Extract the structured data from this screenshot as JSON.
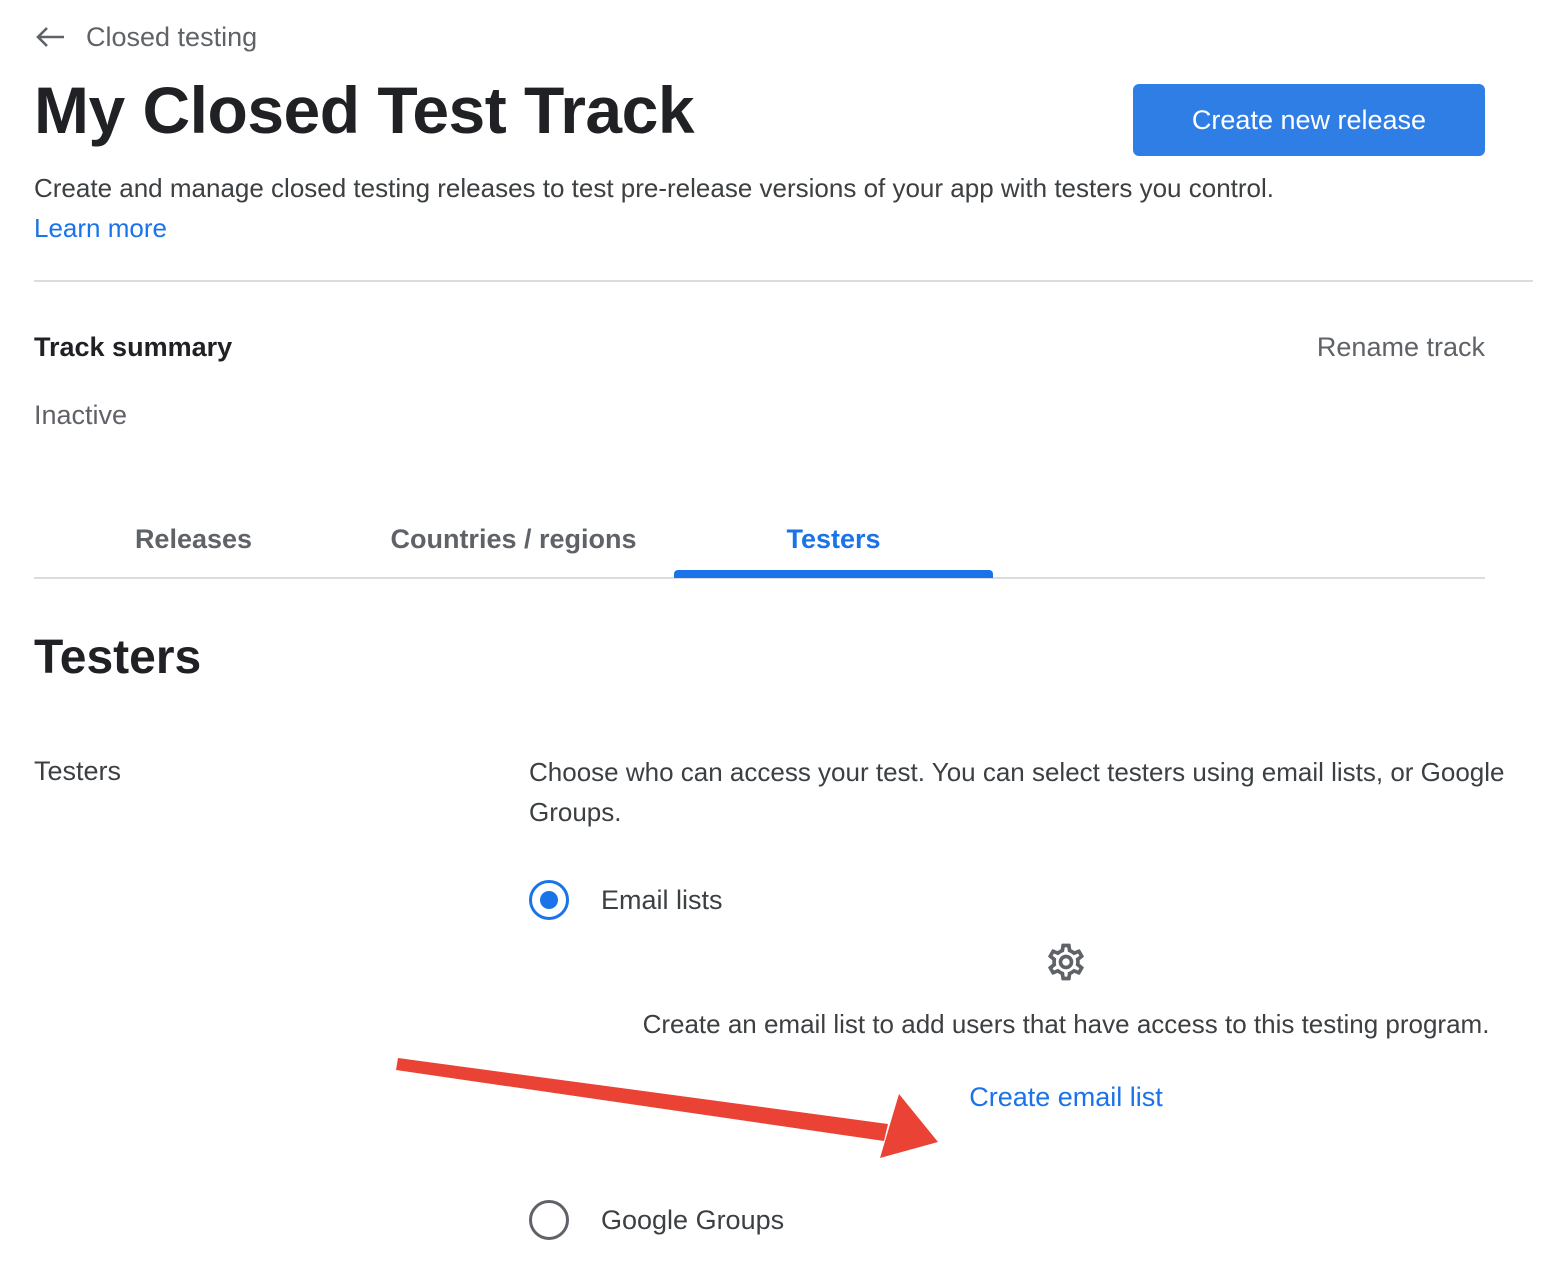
{
  "nav": {
    "back_label": "Closed testing",
    "back_icon": "arrow-left-icon"
  },
  "header": {
    "title": "My Closed Test Track",
    "primary_button": "Create new release",
    "description": "Create and manage closed testing releases to test pre-release versions of your app with testers you control.",
    "learn_more": "Learn more"
  },
  "summary": {
    "title": "Track summary",
    "rename": "Rename track",
    "status": "Inactive"
  },
  "tabs": [
    {
      "label": "Releases",
      "active": false
    },
    {
      "label": "Countries / regions",
      "active": false
    },
    {
      "label": "Testers",
      "active": true
    }
  ],
  "testers_section": {
    "heading": "Testers",
    "field_label": "Testers",
    "help_text": "Choose who can access your test. You can select testers using email lists, or Google Groups.",
    "options": [
      {
        "label": "Email lists",
        "selected": true
      },
      {
        "label": "Google Groups",
        "selected": false
      }
    ],
    "empty_state": {
      "icon": "gear-icon",
      "text": "Create an email list to add users that have access to this testing program.",
      "link": "Create email list"
    }
  },
  "colors": {
    "accent": "#1a73e8",
    "annotation": "#ea4335"
  }
}
